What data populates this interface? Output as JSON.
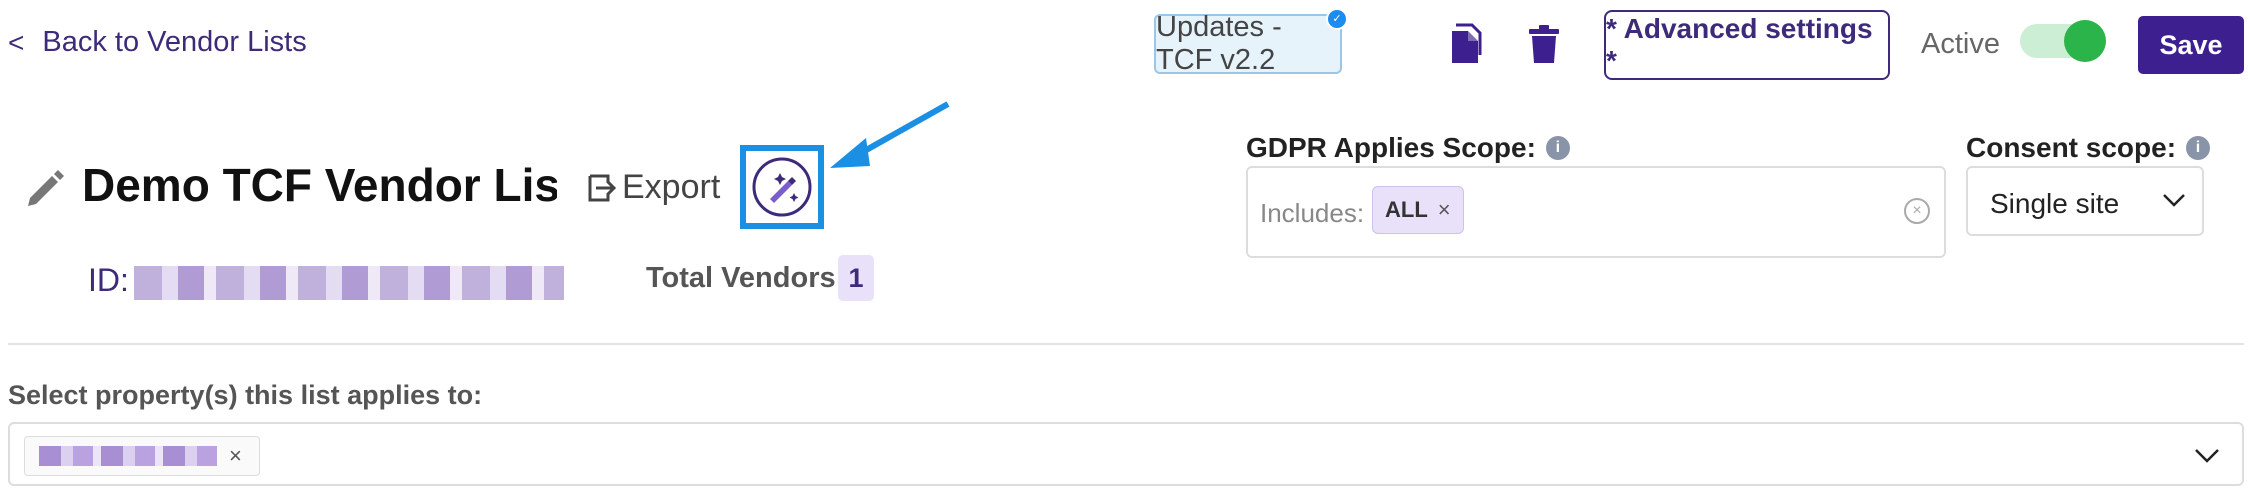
{
  "header": {
    "back_label": "Back to Vendor Lists",
    "update_badge": "Updates - TCF v2.2",
    "advanced_label": "* Advanced settings *",
    "active_label": "Active",
    "active_on": true,
    "save_label": "Save"
  },
  "list": {
    "title": "Demo TCF Vendor List",
    "export_label": "Export",
    "id_label": "ID:",
    "total_vendors_label": "Total Vendors",
    "total_vendors": "1"
  },
  "gdpr": {
    "label": "GDPR Applies Scope:",
    "prefix": "Includes:",
    "tag": "ALL"
  },
  "consent": {
    "label": "Consent scope:",
    "value": "Single site"
  },
  "property": {
    "label": "Select property(s) this list applies to:"
  },
  "colors": {
    "brand": "#3d1f90",
    "highlight": "#1a8fe3",
    "toggle_on": "#2bb44a"
  }
}
